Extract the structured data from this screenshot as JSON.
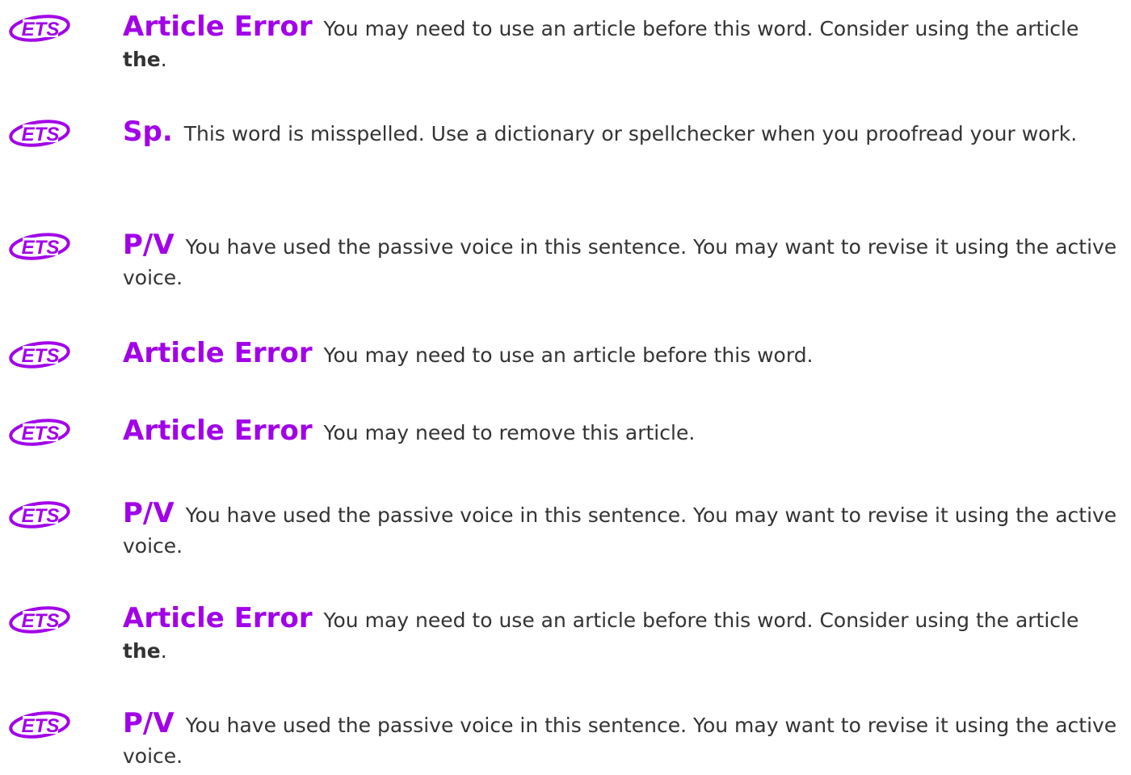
{
  "brand": {
    "logo_text": "ETS",
    "accent_color": "#a100e8"
  },
  "feedback": [
    {
      "title": "Article Error",
      "message": "You may need to use an article before this word. Consider using the article",
      "emphasis": "the",
      "suffix": "."
    },
    {
      "title": "Sp.",
      "message": "This word is misspelled. Use a dictionary or spellchecker when you proofread your work.",
      "emphasis": "",
      "suffix": ""
    },
    {
      "title": "P/V",
      "message": "You have used the passive voice in this sentence. You may want to revise it using the active voice.",
      "emphasis": "",
      "suffix": ""
    },
    {
      "title": "Article Error",
      "message": "You may need to use an article before this word.",
      "emphasis": "",
      "suffix": ""
    },
    {
      "title": "Article Error",
      "message": "You may need to remove this article.",
      "emphasis": "",
      "suffix": ""
    },
    {
      "title": "P/V",
      "message": "You have used the passive voice in this sentence. You may want to revise it using the active voice.",
      "emphasis": "",
      "suffix": ""
    },
    {
      "title": "Article Error",
      "message": "You may need to use an article before this word. Consider using the article",
      "emphasis": "the",
      "suffix": "."
    },
    {
      "title": "P/V",
      "message": "You have used the passive voice in this sentence. You may want to revise it using the active voice.",
      "emphasis": "",
      "suffix": ""
    }
  ]
}
